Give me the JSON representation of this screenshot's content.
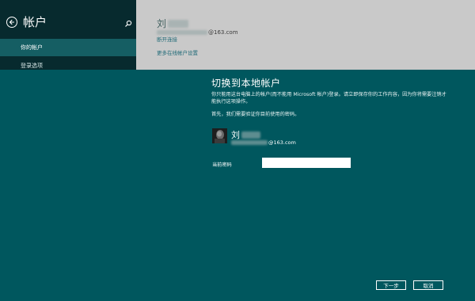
{
  "settings": {
    "title": "帐户",
    "nav": [
      {
        "label": "你的帐户",
        "selected": true
      },
      {
        "label": "登录选项",
        "selected": false
      }
    ],
    "user": {
      "name_visible": "刘",
      "email_suffix": "@163.com"
    },
    "links": {
      "disconnect": "断开连接",
      "more_settings": "更多在线帐户设置"
    }
  },
  "dialog": {
    "title": "切换到本地帐户",
    "description": "你只能用这台电脑上的帐户(而不能用 Microsoft 帐户)登录。请立即保存你的工作内容，因为你将需要注销才能执行这项操作。",
    "verify_text": "首先，我们需要验证你目前使用的密码。",
    "user": {
      "name_visible": "刘",
      "email_suffix": "@163.com"
    },
    "password_label": "当前密码",
    "password_value": "",
    "next_button": "下一步",
    "cancel_button": "取消"
  },
  "colors": {
    "dialog_bg": "#00575e",
    "left_pane_bg": "#072a2e",
    "selected_nav_bg": "#155e63",
    "right_pane_bg": "#c9c9c9"
  },
  "icons": {
    "back": "back-arrow-icon",
    "search": "search-icon"
  }
}
